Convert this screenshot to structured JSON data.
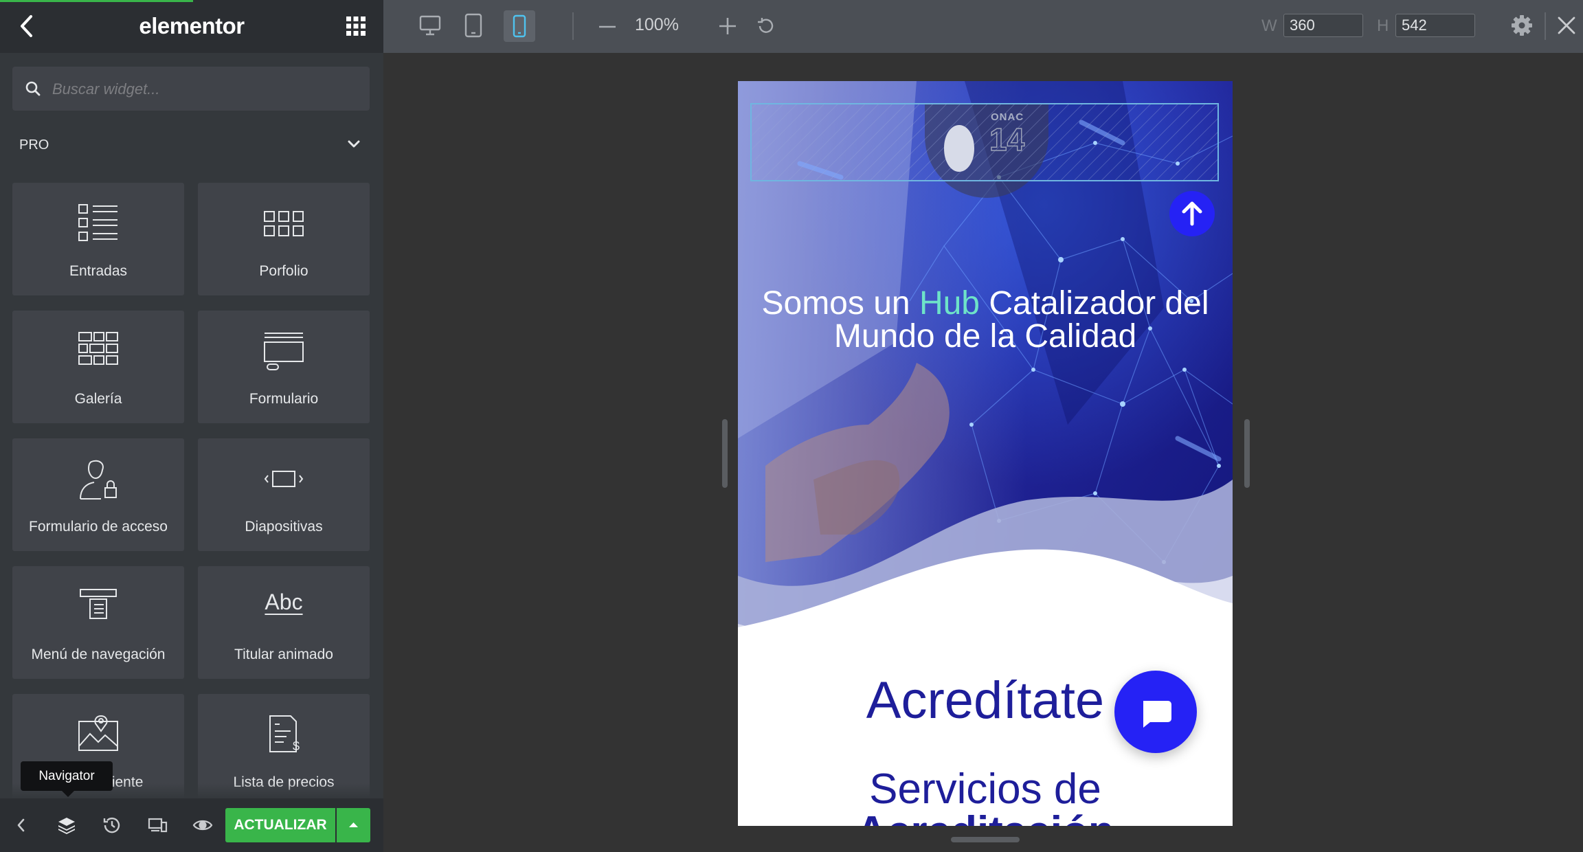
{
  "sidebar": {
    "logo": "elementor",
    "search_placeholder": "Buscar widget...",
    "category": "PRO",
    "widgets": [
      {
        "label": "Entradas",
        "icon": "posts-icon"
      },
      {
        "label": "Porfolio",
        "icon": "portfolio-icon"
      },
      {
        "label": "Galería",
        "icon": "gallery-icon"
      },
      {
        "label": "Formulario",
        "icon": "form-icon"
      },
      {
        "label": "Formulario de acceso",
        "icon": "login-form-icon"
      },
      {
        "label": "Diapositivas",
        "icon": "slides-icon"
      },
      {
        "label": "Menú de navegación",
        "icon": "nav-menu-icon"
      },
      {
        "label": "Titular animado",
        "icon": "animated-headline-icon",
        "glyph": "Abc"
      },
      {
        "label": "Mapa caliente",
        "icon": "hotspot-icon"
      },
      {
        "label": "Lista de precios",
        "icon": "price-list-icon"
      }
    ],
    "tooltip": "Navigator",
    "update_label": "ACTUALIZAR"
  },
  "toolbar": {
    "zoom": "100%",
    "width_label": "W",
    "width_value": "360",
    "height_label": "H",
    "height_value": "542",
    "active_device": "mobile"
  },
  "preview": {
    "logo_text": "ONAC",
    "logo_number": "14",
    "hero_title_part1": "Somos un ",
    "hero_title_highlight": "Hub",
    "hero_title_part2": " Catalizador del",
    "hero_title_line2": "Mundo de la Calidad",
    "heading_1": "Acredítate",
    "heading_2_line1": "Servicios de",
    "heading_2_line2": "Acreditación"
  },
  "colors": {
    "accent_green": "#39b54a",
    "brand_blue": "#2522f5",
    "heading_blue": "#1e1e9a",
    "highlight": "#6ee3c8"
  }
}
